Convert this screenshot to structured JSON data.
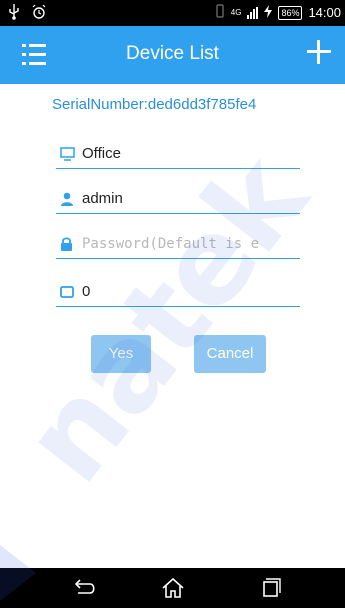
{
  "status_bar": {
    "left_icons": [
      "usb-icon",
      "alarm-icon"
    ],
    "network": "4G",
    "battery": "86%",
    "time": "14:00"
  },
  "header": {
    "title": "Device List",
    "menu_icon": "menu-list-icon",
    "add_icon": "plus-icon"
  },
  "form": {
    "serial": "SerialNumber:ded6dd3f785fe4",
    "name_value": "Office",
    "user_value": "admin",
    "password_placeholder": "Password(Default is e",
    "channel_value": "0"
  },
  "buttons": {
    "yes": "Yes",
    "cancel": "Cancel"
  },
  "watermark": "natek",
  "colors": {
    "header": "#2fa1ef",
    "accent_text": "#2a8fd9",
    "button": "#8ec6f1"
  }
}
